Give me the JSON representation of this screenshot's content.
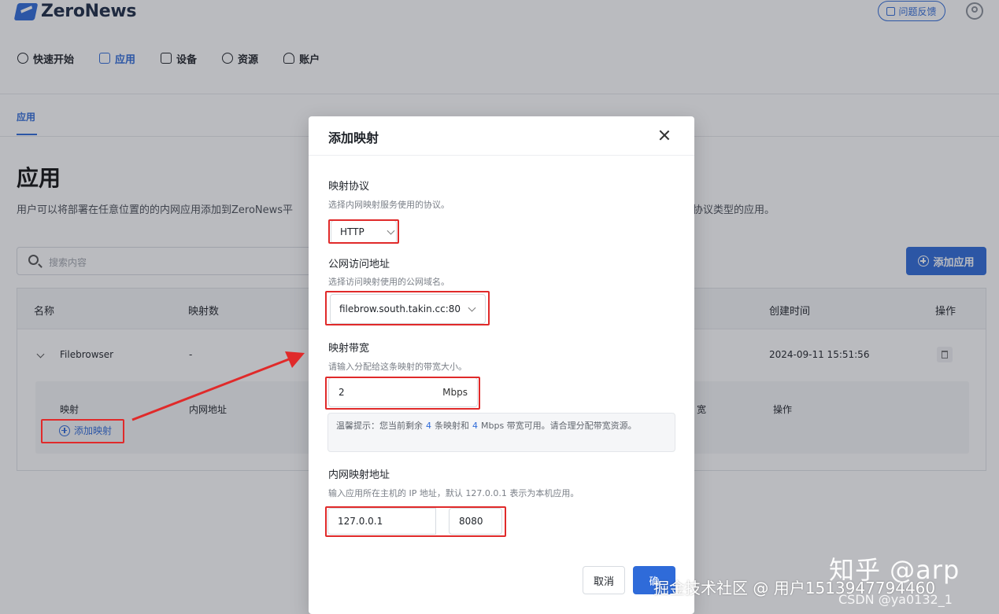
{
  "app": {
    "logo_text": "ZeroNews",
    "feedback_label": "问题反馈"
  },
  "nav": {
    "items": [
      {
        "label": "快速开始",
        "icon": "rocket-icon"
      },
      {
        "label": "应用",
        "icon": "cube-icon"
      },
      {
        "label": "设备",
        "icon": "monitor-icon"
      },
      {
        "label": "资源",
        "icon": "globe-icon"
      },
      {
        "label": "账户",
        "icon": "person-icon"
      }
    ],
    "active": "应用"
  },
  "subtabs": {
    "active": "应用"
  },
  "page": {
    "title": "应用",
    "desc_left": "用户可以将部署在任意位置的的内网应用添加到ZeroNews平",
    "desc_right": "协议类型的应用。",
    "search_placeholder": "搜索内容",
    "add_app_label": "添加应用"
  },
  "table": {
    "headers": {
      "name": "名称",
      "mappings": "映射数",
      "created": "创建时间",
      "actions": "操作"
    },
    "row": {
      "name": "Filebrowser",
      "mappings": "-",
      "created": "2024-09-11 15:51:56"
    },
    "subpanel": {
      "col_mapping": "映射",
      "col_lan": "内网地址",
      "col_bandwidth_partial": "宽",
      "col_actions": "操作",
      "add_mapping_label": "添加映射"
    }
  },
  "modal": {
    "title": "添加映射",
    "protocol": {
      "label": "映射协议",
      "help": "选择内网映射服务使用的协议。",
      "value": "HTTP"
    },
    "domain": {
      "label": "公网访问地址",
      "help": "选择访问映射使用的公网域名。",
      "value": "filebrow.south.takin.cc:80"
    },
    "bandwidth": {
      "label": "映射带宽",
      "help": "请输入分配给这条映射的带宽大小。",
      "value": "2",
      "unit": "Mbps"
    },
    "tip": {
      "prefix": "温馨提示：您当前剩余",
      "remaining_mappings": "4",
      "mid": "条映射和",
      "remaining_bandwidth": "4",
      "suffix": "Mbps 带宽可用。请合理分配带宽资源。"
    },
    "lan": {
      "label": "内网映射地址",
      "help": "输入应用所在主机的 IP 地址，默认 127.0.0.1 表示为本机应用。",
      "ip": "127.0.0.1",
      "port": "8080"
    },
    "cancel_label": "取消",
    "ok_label": "确"
  },
  "watermarks": {
    "zhihu": "知乎 @arp",
    "juejin": "掘金技术社区 @ 用户1513947794460",
    "csdn": "CSDN @ya0132_1"
  },
  "colors": {
    "accent": "#2f6bd9",
    "annotation": "#e02a2a"
  }
}
